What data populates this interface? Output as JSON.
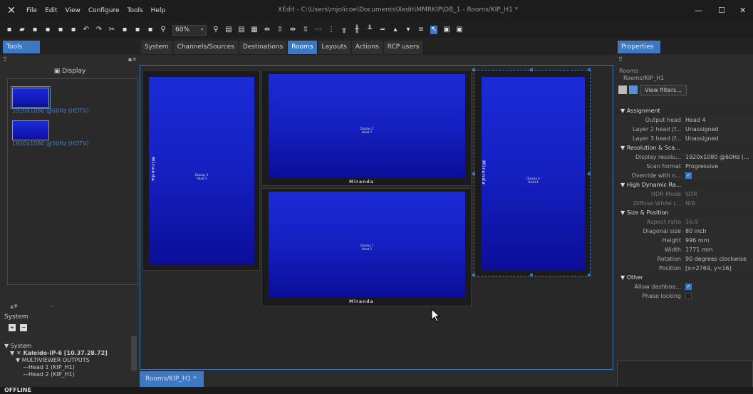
{
  "app": {
    "title": "XEdit - C:\\Users\\mjolicoe\\Documents\\Xedit\\MMRKIP\\DB_1 - Rooms/KIP_H1 *"
  },
  "menu": [
    "File",
    "Edit",
    "View",
    "Configure",
    "Tools",
    "Help"
  ],
  "toolbar": {
    "zoom": "60%"
  },
  "tools_tab": "Tools",
  "tabs": [
    "System",
    "Channels/Sources",
    "Destinations",
    "Rooms",
    "Layouts",
    "Actions",
    "RCP users"
  ],
  "active_tab": "Rooms",
  "properties_tab": "Properties",
  "left": {
    "display_header": "Display",
    "resolutions": [
      {
        "label": "1920x1080 @60Hz (HDTV)",
        "selected": true
      },
      {
        "label": "1920x1080 @50Hz (HDTV)",
        "selected": false
      }
    ],
    "system_label": "System",
    "tree": [
      "System",
      "Kaleido-IP-6 [10.37.28.72]",
      "MULTIVIEWER OUTPUTS",
      "Head 1 (KIP_H1)",
      "Head 2 (KIP_H1)"
    ]
  },
  "canvas": {
    "tab": "Rooms/KIP_H1 *",
    "panels": [
      {
        "line1": "Display 3",
        "line2": "Head 3"
      },
      {
        "line1": "Display 2",
        "line2": "Head 2"
      },
      {
        "line1": "Display 1",
        "line2": "Head 1"
      },
      {
        "line1": "Display 4",
        "line2": "Head 4"
      }
    ],
    "brand": "Miranda"
  },
  "right": {
    "rooms_label": "Rooms",
    "rooms_path": "Rooms/KIP_H1",
    "view_filters": "View filters...",
    "rows": [
      {
        "cat": "Assignment"
      },
      {
        "k": "Output head",
        "v": "Head 4"
      },
      {
        "k": "Layer 2 head (f...",
        "v": "Unassigned"
      },
      {
        "k": "Layer 3 head (f...",
        "v": "Unassigned"
      },
      {
        "cat": "Resolution & Sca..."
      },
      {
        "k": "Display resolu...",
        "v": "1920x1080 @60Hz (..."
      },
      {
        "k": "Scan format",
        "v": "Progressive"
      },
      {
        "k": "Override with n...",
        "check": true
      },
      {
        "cat": "High Dynamic Ra..."
      },
      {
        "k": "HDR Mode",
        "v": "SDR",
        "dis": true
      },
      {
        "k": "Diffuse White (...",
        "v": "N/A",
        "dis": true
      },
      {
        "cat": "Size & Position"
      },
      {
        "k": "Aspect ratio",
        "v": "16:9",
        "dis": true
      },
      {
        "k": "Diagonal size",
        "v": "80 inch"
      },
      {
        "k": "Height",
        "v": "996 mm"
      },
      {
        "k": "Width",
        "v": "1771 mm"
      },
      {
        "k": "Rotation",
        "v": "90 degrees clockwise"
      },
      {
        "k": "Position",
        "v": "[x=2769, y=16]"
      },
      {
        "cat": "Other"
      },
      {
        "k": "Allow dashboa...",
        "check": true
      },
      {
        "k": "Phase locking",
        "check": false
      }
    ]
  },
  "status": "OFFLINE"
}
